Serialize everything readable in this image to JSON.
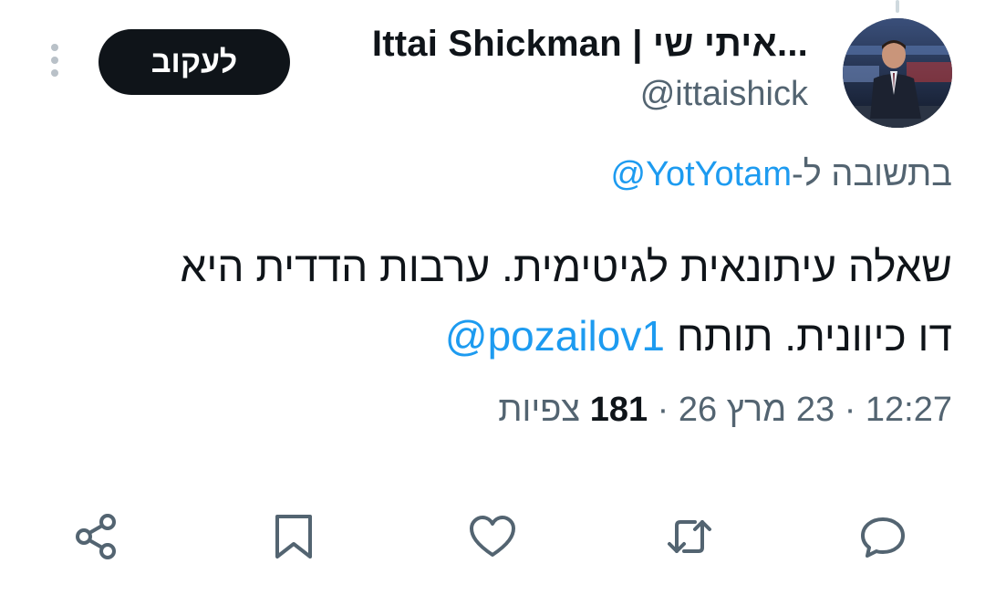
{
  "author": {
    "display_name": "Ittai Shickman | איתי שי...",
    "handle": "@ittaishick"
  },
  "follow_label": "לעקוב",
  "reply_context": {
    "prefix": "בתשובה ל-",
    "mention": "@YotYotam"
  },
  "tweet": {
    "line1": "שאלה עיתונאית לגיטימית. ערבות הדדית היא",
    "line2_text": "דו כיוונית. תותח",
    "line2_mention": "@pozailov1"
  },
  "meta": {
    "time": "12:27",
    "date": "23 מרץ 26",
    "views_count": "181",
    "views_label": "צפיות",
    "separator": "·"
  },
  "icons": {
    "more": "more-vertical-icon",
    "reply": "reply-bubble-icon",
    "repost": "repost-arrows-icon",
    "like": "heart-icon",
    "bookmark": "bookmark-icon",
    "share": "share-icon"
  },
  "colors": {
    "text": "#0f1419",
    "secondary": "#536471",
    "link": "#1d9bf0",
    "button_bg": "#0f1419",
    "button_text": "#ffffff"
  }
}
